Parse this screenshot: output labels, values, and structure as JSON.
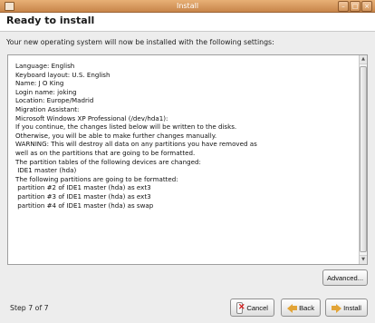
{
  "window": {
    "title": "Install",
    "controls": [
      "minimize",
      "maximize",
      "close"
    ]
  },
  "header": {
    "title": "Ready to install"
  },
  "intro": "Your new operating system will now be installed with the following settings:",
  "summary": {
    "lines": [
      "Language: English",
      "Keyboard layout: U.S. English",
      "Name: J O King",
      "Login name: joking",
      "Location: Europe/Madrid",
      "Migration Assistant:",
      "Microsoft Windows XP Professional (/dev/hda1):",
      "",
      "",
      "If you continue, the changes listed below will be written to the disks.",
      "Otherwise, you will be able to make further changes manually.",
      "",
      "WARNING: This will destroy all data on any partitions you have removed as",
      "well as on the partitions that are going to be formatted.",
      "",
      "The partition tables of the following devices are changed:",
      " IDE1 master (hda)",
      "",
      "The following partitions are going to be formatted:",
      " partition #2 of IDE1 master (hda) as ext3",
      " partition #3 of IDE1 master (hda) as ext3",
      " partition #4 of IDE1 master (hda) as swap"
    ]
  },
  "advanced_button": "Advanced...",
  "footer": {
    "step": "Step 7 of 7",
    "cancel": "Cancel",
    "back": "Back",
    "install": "Install"
  },
  "icons": {
    "cancel": "cancel-icon",
    "back": "back-arrow-icon",
    "install": "forward-arrow-icon"
  }
}
